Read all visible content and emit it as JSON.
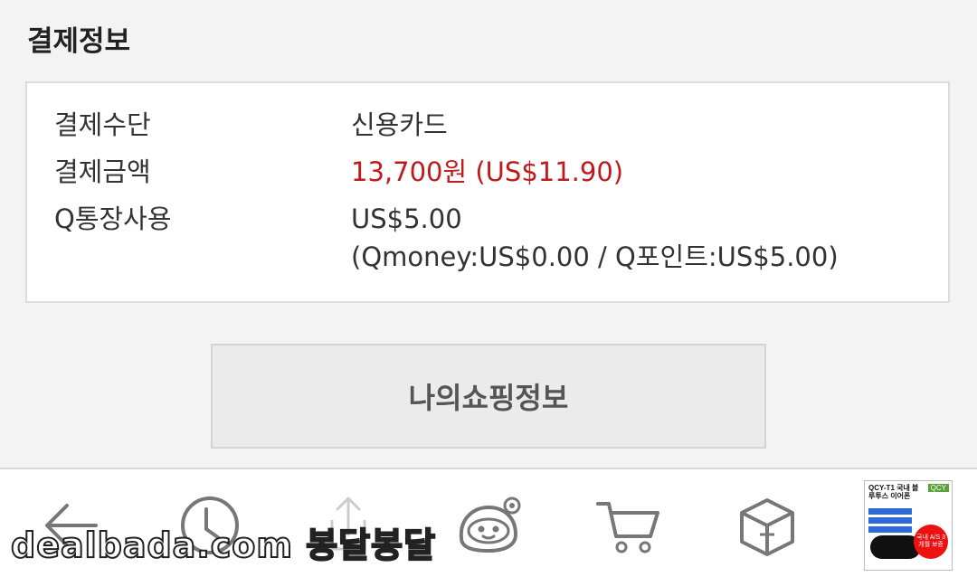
{
  "section": {
    "title": "결제정보"
  },
  "payment": {
    "rows": [
      {
        "label": "결제수단",
        "value": "신용카드"
      },
      {
        "label": "결제금액",
        "value": "13,700원 (US$11.90)"
      },
      {
        "label": "Q통장사용",
        "value": "US$5.00",
        "sub_value": "(Qmoney:US$0.00 / Q포인트:US$5.00)"
      }
    ],
    "amount_color": "#c11a1a"
  },
  "shop_button": {
    "label": "나의쇼핑정보"
  },
  "bottom_nav": {
    "icons": [
      "back-arrow-icon",
      "history-clock-icon",
      "share-icon",
      "mascot-icon",
      "cart-icon",
      "box-icon"
    ],
    "thumbnail": {
      "title": "QCY-T1 국내 블루투스 이어폰",
      "brand": "QCY",
      "badge": "국내 A/S 3개월 보증"
    }
  },
  "watermark": {
    "text": "dealbada.com 봉달봉달"
  }
}
